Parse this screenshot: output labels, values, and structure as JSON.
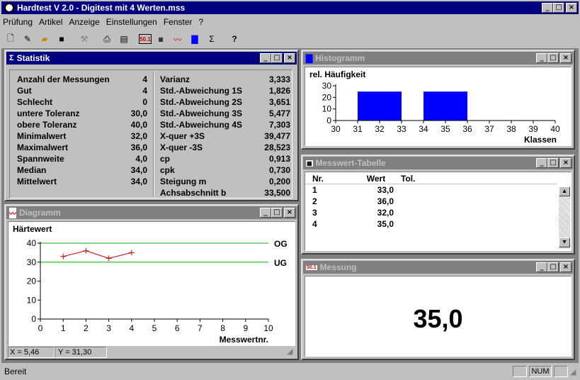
{
  "app": {
    "title": "Hardtest V 2.0 - Digitest mit 4 Werten.mss"
  },
  "menu": [
    "Prüfung",
    "Artikel",
    "Anzeige",
    "Einstellungen",
    "Fenster",
    "?"
  ],
  "toolbar": [
    "new-icon",
    "edit-icon",
    "open-icon",
    "save-icon",
    "tool-icon",
    "print-icon",
    "preview-icon",
    "measure-icon",
    "table-icon",
    "diagram-icon",
    "histogram-icon",
    "statistics-icon",
    "help-icon"
  ],
  "statistik": {
    "title": "Statistik",
    "left": [
      {
        "label": "Anzahl der Messungen",
        "value": "4"
      },
      {
        "label": "Gut",
        "value": "4"
      },
      {
        "label": "Schlecht",
        "value": "0"
      },
      {
        "label": "untere Toleranz",
        "value": "30,0"
      },
      {
        "label": "obere Toleranz",
        "value": "40,0"
      },
      {
        "label": "Minimalwert",
        "value": "32,0"
      },
      {
        "label": "Maximalwert",
        "value": "36,0"
      },
      {
        "label": "Spannweite",
        "value": "4,0"
      },
      {
        "label": "Median",
        "value": "34,0"
      },
      {
        "label": "Mittelwert",
        "value": "34,0"
      }
    ],
    "right": [
      {
        "label": "Varianz",
        "value": "3,333"
      },
      {
        "label": "Std.-Abweichung 1S",
        "value": "1,826"
      },
      {
        "label": "Std.-Abweichung 2S",
        "value": "3,651"
      },
      {
        "label": "Std.-Abweichung 3S",
        "value": "5,477"
      },
      {
        "label": "Std.-Abweichung 4S",
        "value": "7,303"
      },
      {
        "label": "X-quer +3S",
        "value": "39,477"
      },
      {
        "label": "X-quer -3S",
        "value": "28,523"
      },
      {
        "label": "cp",
        "value": "0,913"
      },
      {
        "label": "cpk",
        "value": "0,730"
      },
      {
        "label": "Steigung m",
        "value": "0,200"
      },
      {
        "label": "Achsabschnitt b",
        "value": "33,500"
      }
    ]
  },
  "histogramm": {
    "title": "Histogramm"
  },
  "tabelle": {
    "title": "Messwert-Tabelle",
    "headers": [
      "Nr.",
      "Wert",
      "Tol."
    ],
    "rows": [
      [
        "1",
        "33,0",
        ""
      ],
      [
        "2",
        "36,0",
        ""
      ],
      [
        "3",
        "32,0",
        ""
      ],
      [
        "4",
        "35,0",
        ""
      ]
    ]
  },
  "diagramm": {
    "title": "Diagramm",
    "status_x": "X = 5,46",
    "status_y": "Y = 31,30"
  },
  "messung": {
    "title": "Messung",
    "value": "35,0"
  },
  "status": {
    "text": "Bereit",
    "num": "NUM"
  },
  "chart_data": [
    {
      "type": "bar",
      "title": "rel. Häufigkeit",
      "xlabel": "Klassen",
      "ylim": [
        0,
        30
      ],
      "yticks": [
        0,
        10,
        20,
        30
      ],
      "xticks": [
        30,
        31,
        32,
        33,
        34,
        35,
        36,
        37,
        38,
        39,
        40
      ],
      "bins": [
        {
          "from": 31,
          "to": 33,
          "value": 25
        },
        {
          "from": 34,
          "to": 36,
          "value": 25
        }
      ],
      "color": "#0000ff"
    },
    {
      "type": "line",
      "title": "Härtewert",
      "xlabel": "Messwertnr.",
      "xlim": [
        0,
        10
      ],
      "ylim": [
        0,
        40
      ],
      "xticks": [
        0,
        1,
        2,
        3,
        4,
        5,
        6,
        7,
        8,
        9,
        10
      ],
      "yticks": [
        0,
        10,
        20,
        30,
        40
      ],
      "x": [
        1,
        2,
        3,
        4
      ],
      "y": [
        33,
        36,
        32,
        35
      ],
      "color": "#cc0000",
      "limits": [
        {
          "label": "OG",
          "value": 40
        },
        {
          "label": "UG",
          "value": 30
        }
      ],
      "limit_color": "#00b000"
    }
  ]
}
